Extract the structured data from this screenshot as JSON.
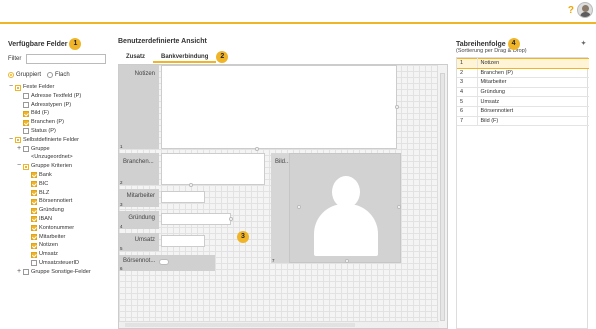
{
  "header": {
    "help_label": "?",
    "avatar_icon": "user-avatar"
  },
  "left_panel": {
    "title": "Verfügbare Felder",
    "badge": "1",
    "filter_label": "Filter",
    "filter_value": "",
    "radio_grouped": "Gruppiert",
    "radio_flat": "Flach",
    "tree": [
      {
        "label": "Feste Felder",
        "level": 0,
        "toggle": "−",
        "check": "part"
      },
      {
        "label": "Adresse Textfeld (P)",
        "level": 1,
        "toggle": "",
        "check": "off"
      },
      {
        "label": "Adresstypen (P)",
        "level": 1,
        "toggle": "",
        "check": "off"
      },
      {
        "label": "Bild (F)",
        "level": 1,
        "toggle": "",
        "check": "on"
      },
      {
        "label": "Branchen (P)",
        "level": 1,
        "toggle": "",
        "check": "on"
      },
      {
        "label": "Status (P)",
        "level": 1,
        "toggle": "",
        "check": "off"
      },
      {
        "label": "Selbstdefinierte Felder",
        "level": 0,
        "toggle": "−",
        "check": "part"
      },
      {
        "label": "Gruppe",
        "level": 1,
        "toggle": "+",
        "check": "off"
      },
      {
        "label": "<Unzugeordnet>",
        "level": 2,
        "toggle": "",
        "check": "none"
      },
      {
        "label": "Gruppe Kriterien",
        "level": 1,
        "toggle": "−",
        "check": "part"
      },
      {
        "label": "Bank",
        "level": 2,
        "toggle": "",
        "check": "on"
      },
      {
        "label": "BIC",
        "level": 2,
        "toggle": "",
        "check": "on"
      },
      {
        "label": "BLZ",
        "level": 2,
        "toggle": "",
        "check": "on"
      },
      {
        "label": "Börsennotiert",
        "level": 2,
        "toggle": "",
        "check": "on"
      },
      {
        "label": "Gründung",
        "level": 2,
        "toggle": "",
        "check": "on"
      },
      {
        "label": "IBAN",
        "level": 2,
        "toggle": "",
        "check": "on"
      },
      {
        "label": "Kontonummer",
        "level": 2,
        "toggle": "",
        "check": "on"
      },
      {
        "label": "Mitarbeiter",
        "level": 2,
        "toggle": "",
        "check": "on"
      },
      {
        "label": "Notizen",
        "level": 2,
        "toggle": "",
        "check": "on"
      },
      {
        "label": "Umsatz",
        "level": 2,
        "toggle": "",
        "check": "on"
      },
      {
        "label": "UmsatzsteuerID",
        "level": 2,
        "toggle": "",
        "check": "off"
      },
      {
        "label": "Gruppe Sonstige-Felder",
        "level": 1,
        "toggle": "+",
        "check": "off"
      }
    ]
  },
  "middle_panel": {
    "title": "Benutzerdefinierte Ansicht",
    "tabs": [
      "Zusatz",
      "Bankverbindung"
    ],
    "tabs_badge": "2",
    "designer_badge": "3",
    "fields": {
      "notizen": "Notizen",
      "branchen": "Branchen...",
      "bild": "Bild...",
      "mitarbeiter": "Mitarbeiter",
      "gruendung": "Gründung",
      "umsatz": "Umsatz",
      "boersen": "Börsennot..."
    },
    "row_numbers": [
      "1",
      "2",
      "3",
      "4",
      "5",
      "6",
      "7"
    ]
  },
  "right_panel": {
    "title": "Tabreihenfolge",
    "badge": "4",
    "subtitle": "(Sortierung per Drag & Drop)",
    "rows": [
      {
        "n": "1",
        "label": "Notizen"
      },
      {
        "n": "2",
        "label": "Branchen (P)"
      },
      {
        "n": "3",
        "label": "Mitarbeiter"
      },
      {
        "n": "4",
        "label": "Gründung"
      },
      {
        "n": "5",
        "label": "Umsatz"
      },
      {
        "n": "6",
        "label": "Börsennotiert"
      },
      {
        "n": "7",
        "label": "Bild (F)"
      }
    ]
  }
}
